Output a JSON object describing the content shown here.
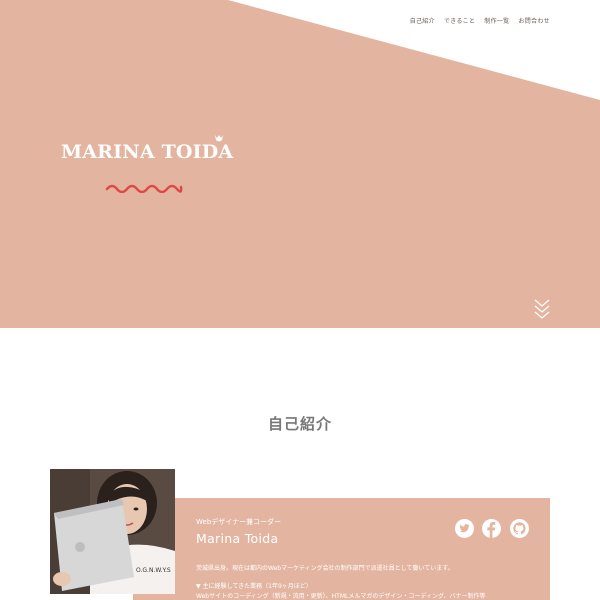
{
  "nav": {
    "items": [
      "自己紹介",
      "できること",
      "制作一覧",
      "お問合わせ"
    ]
  },
  "hero": {
    "logo_text": "MARINA TOIDA"
  },
  "about": {
    "section_title": "自己紹介",
    "role": "Webデザイナー兼コーダー",
    "name": "Marina Toida",
    "bio": "茨城県出身。現在は都内のWebマーケティング会社の制作部門で派遣社員として働いています。",
    "experience_heading": "▼ 主に経験してきた業務（1年9ヶ月ほど）",
    "experience_detail": "Webサイトのコーディング（新規・流用・更新）、HTMLメルマガのデザイン・コーディング、バナー制作等",
    "photo_shirt_text": "O.G.N.W.Y.S"
  },
  "colors": {
    "accent": "#e3b5a0",
    "wave": "#e04848",
    "text": "#777777",
    "white": "#ffffff"
  },
  "icons": {
    "social": [
      "twitter-icon",
      "facebook-icon",
      "github-icon"
    ],
    "scroll": "chevron-down-icon"
  }
}
